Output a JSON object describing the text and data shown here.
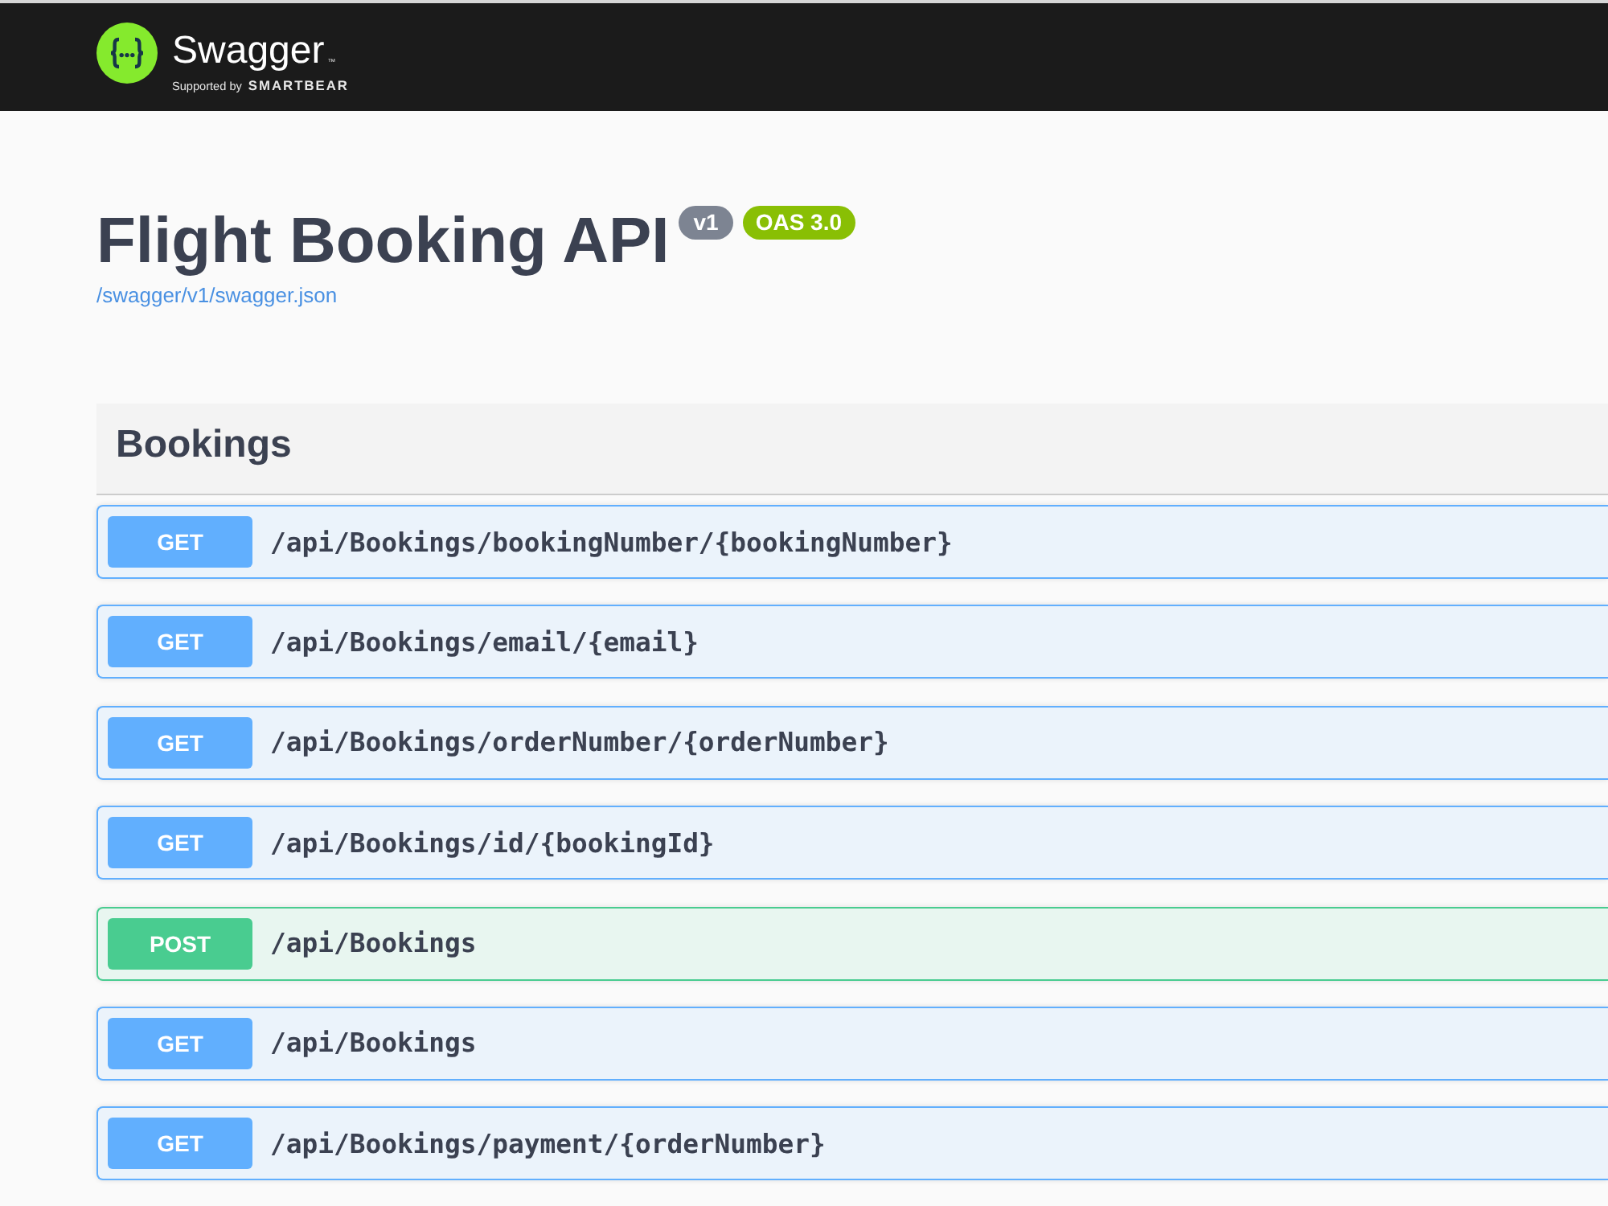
{
  "topbar": {
    "product": "Swagger",
    "trademark": "™",
    "tagline": "Supported by",
    "sponsor": "SMARTBEAR"
  },
  "info": {
    "title": "Flight Booking API",
    "badges": [
      {
        "text": "v1",
        "kind": "version"
      },
      {
        "text": "OAS 3.0",
        "kind": "spec"
      }
    ],
    "link": "/swagger/v1/swagger.json"
  },
  "sections": [
    {
      "name": "Bookings",
      "operations": [
        {
          "method": "GET",
          "kind": "get",
          "path": "/api/Bookings/bookingNumber/{bookingNumber}"
        },
        {
          "method": "GET",
          "kind": "get",
          "path": "/api/Bookings/email/{email}"
        },
        {
          "method": "GET",
          "kind": "get",
          "path": "/api/Bookings/orderNumber/{orderNumber}"
        },
        {
          "method": "GET",
          "kind": "get",
          "path": "/api/Bookings/id/{bookingId}"
        },
        {
          "method": "POST",
          "kind": "post",
          "path": "/api/Bookings"
        },
        {
          "method": "GET",
          "kind": "get",
          "path": "/api/Bookings"
        },
        {
          "method": "GET",
          "kind": "get",
          "path": "/api/Bookings/payment/{orderNumber}"
        }
      ]
    }
  ]
}
